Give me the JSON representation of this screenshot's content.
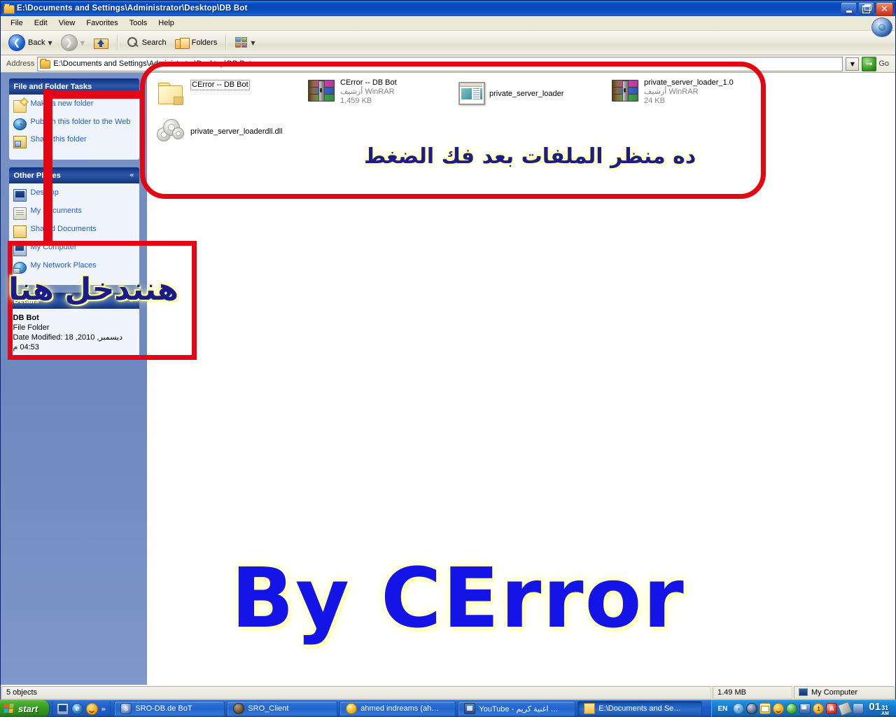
{
  "window": {
    "title": "E:\\Documents and Settings\\Administrator\\Desktop\\DB Bot",
    "minimize_label": "Minimize",
    "restore_label": "Restore",
    "close_label": "Close"
  },
  "menubar": {
    "items": [
      {
        "label": "File"
      },
      {
        "label": "Edit"
      },
      {
        "label": "View"
      },
      {
        "label": "Favorites"
      },
      {
        "label": "Tools"
      },
      {
        "label": "Help"
      }
    ]
  },
  "toolbar": {
    "back_label": "Back",
    "search_label": "Search",
    "folders_label": "Folders"
  },
  "address": {
    "label": "Address",
    "value": "E:\\Documents and Settings\\Administrator\\Desktop\\DB Bot",
    "go_label": "Go"
  },
  "sidebar": {
    "tasks_panel": {
      "title": "File and Folder Tasks",
      "items": [
        {
          "label": "Make a new folder",
          "icon": "new-folder-icon"
        },
        {
          "label": "Publish this folder to the Web",
          "icon": "globe-icon"
        },
        {
          "label": "Share this folder",
          "icon": "share-folder-icon"
        }
      ]
    },
    "other_places_panel": {
      "title": "Other Places",
      "collapse_glyph": "«",
      "items": [
        {
          "label": "Desktop",
          "icon": "desktop-icon"
        },
        {
          "label": "My Documents",
          "icon": "documents-icon"
        },
        {
          "label": "Shared Documents",
          "icon": "shared-documents-icon"
        },
        {
          "label": "My Computer",
          "icon": "my-computer-icon"
        },
        {
          "label": "My Network Places",
          "icon": "network-icon"
        }
      ]
    },
    "details_panel": {
      "title": "Details",
      "collapse_glyph": "»",
      "name": "DB Bot",
      "type": "File Folder",
      "date_modified": "Date Modified: 18 ديسمبر, 2010, 04:53 م"
    }
  },
  "files": [
    {
      "name": "CError -- DB Bot",
      "type": "",
      "size": "",
      "icon": "folder-icon",
      "selected": true
    },
    {
      "name": "CError -- DB Bot",
      "type": "أرشيف WinRAR",
      "size": "1,459 KB",
      "icon": "winrar-archive-icon",
      "selected": false
    },
    {
      "name": "private_server_loader",
      "type": "",
      "size": "",
      "icon": "application-icon",
      "selected": false
    },
    {
      "name": "private_server_loader_1.0",
      "type": "أرشيف WinRAR",
      "size": "24 KB",
      "icon": "winrar-archive-icon",
      "selected": false
    },
    {
      "name": "private_server_loaderdll.dll",
      "type": "",
      "size": "",
      "icon": "dll-icon",
      "selected": false
    }
  ],
  "statusbar": {
    "objects": "5 objects",
    "size": "1.49 MB",
    "location": "My Computer"
  },
  "annotations": {
    "arabic_top": "ده منظر الملفات بعد فك الضغط",
    "arabic_side": "هنندخل هنا",
    "watermark": "By CError",
    "highlight_color": "#e30613",
    "annotation_text_color": "#1b1b8a",
    "annotation_glow_color": "#ffff9e",
    "watermark_color": "#1414e6"
  },
  "taskbar": {
    "start_label": "start",
    "quick_launch": [
      {
        "name": "show-desktop-icon"
      },
      {
        "name": "internet-explorer-icon",
        "glyph": "e"
      },
      {
        "name": "messenger-icon"
      },
      {
        "name": "more-icon",
        "glyph": "»"
      }
    ],
    "windows": [
      {
        "label": "SRO-DB.de BoT",
        "icon": "sro-bot-icon",
        "active": false
      },
      {
        "label": "SRO_Client",
        "icon": "sro-client-icon",
        "active": false
      },
      {
        "label": "ahmed indreams (ah…",
        "icon": "messenger-icon",
        "active": false
      },
      {
        "label": "YouTube - اغنية كريم …",
        "icon": "youtube-icon",
        "active": false
      },
      {
        "label": "E:\\Documents and Se…",
        "icon": "folder-icon",
        "active": true
      }
    ],
    "language": "EN",
    "tray_expand_glyph": "‹",
    "tray_icons": [
      {
        "name": "sro-tray-icon"
      },
      {
        "name": "mail-icon"
      },
      {
        "name": "messenger-tray-icon"
      },
      {
        "name": "shield-icon"
      },
      {
        "name": "network-tray-icon"
      },
      {
        "name": "download-manager-icon",
        "glyph": "1"
      },
      {
        "name": "antivirus-icon",
        "glyph": "A"
      },
      {
        "name": "pen-tool-icon"
      },
      {
        "name": "media-icon"
      }
    ],
    "clock_hour": "01",
    "clock_minutes": "31",
    "clock_ampm": "AM"
  }
}
